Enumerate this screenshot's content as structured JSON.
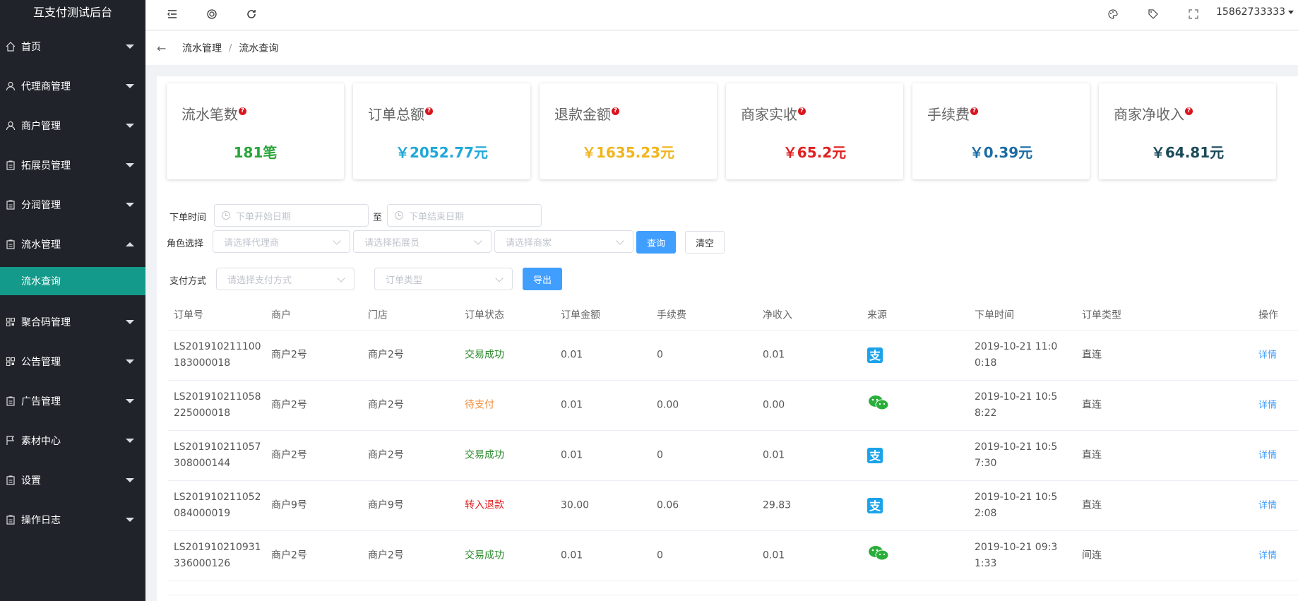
{
  "app": {
    "title": "互支付测试后台",
    "user": "15862733333"
  },
  "sidebar": {
    "items": [
      {
        "label": "首页",
        "icon": "home-icon"
      },
      {
        "label": "代理商管理",
        "icon": "user-icon"
      },
      {
        "label": "商户管理",
        "icon": "user-icon"
      },
      {
        "label": "拓展员管理",
        "icon": "clipboard-icon"
      },
      {
        "label": "分润管理",
        "icon": "clipboard-icon"
      },
      {
        "label": "流水管理",
        "icon": "clipboard-icon",
        "open": true
      },
      {
        "label": "聚合码管理",
        "icon": "qrcode-icon"
      },
      {
        "label": "公告管理",
        "icon": "qrcode-icon"
      },
      {
        "label": "广告管理",
        "icon": "clipboard-icon"
      },
      {
        "label": "素材中心",
        "icon": "flag-icon"
      },
      {
        "label": "设置",
        "icon": "clipboard-icon"
      },
      {
        "label": "操作日志",
        "icon": "clipboard-icon"
      }
    ],
    "sub_active": "流水查询"
  },
  "breadcrumb": {
    "parent": "流水管理",
    "current": "流水查询",
    "separator": "/"
  },
  "stats": [
    {
      "label": "流水笔数",
      "value": "181笔",
      "color": "#2aa43a"
    },
    {
      "label": "订单总额",
      "value": "￥2052.77元",
      "color": "#1fa8d8"
    },
    {
      "label": "退款金额",
      "value": "￥1635.23元",
      "color": "#f0b51d"
    },
    {
      "label": "商家实收",
      "value": "￥65.2元",
      "color": "#e02020"
    },
    {
      "label": "手续费",
      "value": "￥0.39元",
      "color": "#1c6ca4"
    },
    {
      "label": "商家净收入",
      "value": "￥64.81元",
      "color": "#1a4a58"
    }
  ],
  "filters": {
    "order_time_label": "下单时间",
    "start_placeholder": "下单开始日期",
    "to_label": "至",
    "end_placeholder": "下单结束日期",
    "role_label": "角色选择",
    "agent_placeholder": "请选择代理商",
    "staff_placeholder": "请选择拓展员",
    "merchant_placeholder": "请选择商家",
    "query_button": "查询",
    "clear_button": "清空",
    "pay_label": "支付方式",
    "pay_placeholder": "请选择支付方式",
    "order_type_placeholder": "订单类型",
    "export_button": "导出"
  },
  "table": {
    "columns": [
      "订单号",
      "商户",
      "门店",
      "订单状态",
      "订单金额",
      "手续费",
      "净收入",
      "来源",
      "下单时间",
      "订单类型",
      "操作"
    ],
    "rows": [
      {
        "id": "LS201910211100183000018",
        "merchant": "商户2号",
        "store": "商户2号",
        "status": "交易成功",
        "status_color": "#2c8a2c",
        "amount": "0.01",
        "fee": "0",
        "net": "0.01",
        "source": "alipay",
        "time": "2019-10-21 11:00:18",
        "type": "直连",
        "op": "详情"
      },
      {
        "id": "LS201910211058225000018",
        "merchant": "商户2号",
        "store": "商户2号",
        "status": "待支付",
        "status_color": "#f08c3a",
        "amount": "0.01",
        "fee": "0.00",
        "net": "0.00",
        "source": "wechat",
        "time": "2019-10-21 10:58:22",
        "type": "直连",
        "op": "详情"
      },
      {
        "id": "LS201910211057308000144",
        "merchant": "商户2号",
        "store": "商户2号",
        "status": "交易成功",
        "status_color": "#2c8a2c",
        "amount": "0.01",
        "fee": "0",
        "net": "0.01",
        "source": "alipay",
        "time": "2019-10-21 10:57:30",
        "type": "直连",
        "op": "详情"
      },
      {
        "id": "LS201910211052084000019",
        "merchant": "商户9号",
        "store": "商户9号",
        "status": "转入退款",
        "status_color": "#e02020",
        "amount": "30.00",
        "fee": "0.06",
        "net": "29.83",
        "source": "alipay",
        "time": "2019-10-21 10:52:08",
        "type": "直连",
        "op": "详情"
      },
      {
        "id": "LS201910210931336000126",
        "merchant": "商户2号",
        "store": "商户2号",
        "status": "交易成功",
        "status_color": "#2c8a2c",
        "amount": "0.01",
        "fee": "0",
        "net": "0.01",
        "source": "wechat",
        "time": "2019-10-21 09:31:33",
        "type": "间连",
        "op": "详情"
      }
    ]
  }
}
